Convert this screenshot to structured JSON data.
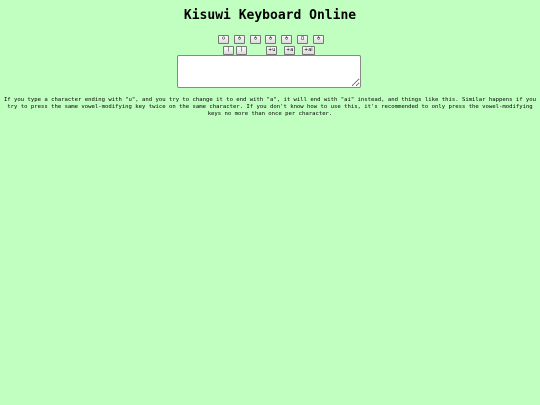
{
  "title": "Kisuwi Keyboard Online",
  "keyboard": {
    "row1": [
      "ㅇ",
      "ㅎ",
      "ㅎ",
      "ㅎ",
      "ㅎ",
      "ㅁ",
      "ㅎ"
    ],
    "row2": [
      "ㅣ",
      "ㅣ",
      "+u",
      "+a",
      "+ai"
    ]
  },
  "textarea": {
    "value": "",
    "placeholder": ""
  },
  "note": {
    "lines": [
      "If you type a character ending with \"u\", and you try to change it to end with \"a\", it will end with \"ai\" instead, and things like this. Similar happens if you",
      "try to press the same vowel-modifying key twice on the same character. If you don't know how to use this, it's recommended to only press the vowel-modifying",
      "keys no more than once per character."
    ]
  },
  "colors": {
    "background": "#c0ffc0"
  }
}
